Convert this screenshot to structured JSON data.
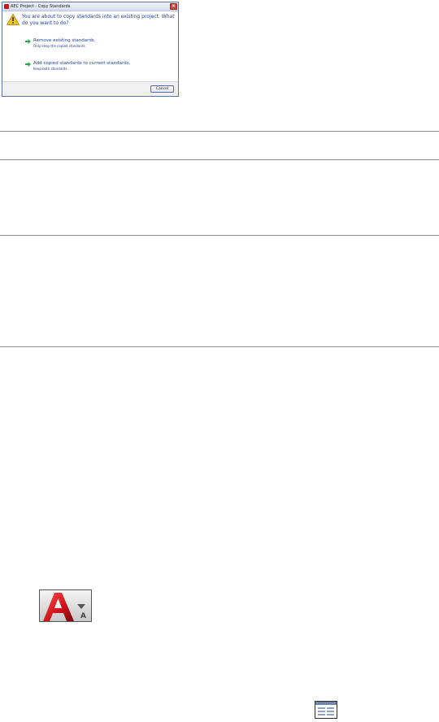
{
  "dialog": {
    "title": "AEC Project - Copy Standards",
    "close_glyph": "×",
    "message": "You are about to copy standards into an existing project. What do you want to do?",
    "options": [
      {
        "label": "Remove existing standards.",
        "description": "Only keep the copied standards."
      },
      {
        "label": "Add copied standards to current standards.",
        "description": "Keep both standards."
      }
    ],
    "cancel_label": "Cancel",
    "icons": {
      "title": "app-icon",
      "warning": "warning-icon",
      "option_arrow": "green-arrow-icon"
    },
    "colors": {
      "message_text": "#1c3f97",
      "arrow": "#2aa84a",
      "close": "#d0433a"
    }
  },
  "app_button": {
    "icon": "application-button-icon",
    "subscript": "A"
  },
  "window_icon": {
    "icon": "window-layout-icon"
  }
}
